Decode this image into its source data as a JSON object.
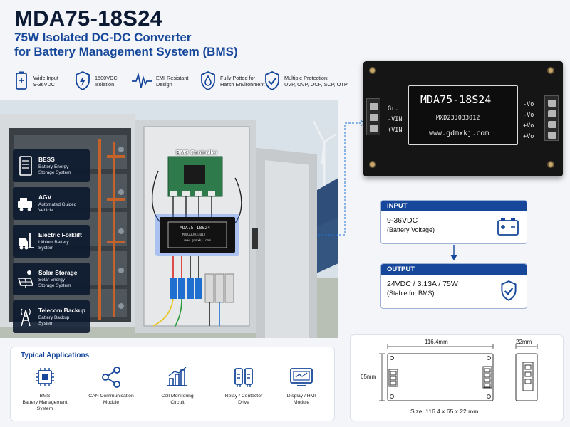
{
  "header": {
    "title": "MDA75-18S24",
    "subtitle_line1": "75W Isolated DC-DC Converter",
    "subtitle_line2": "for Battery Management System (BMS)"
  },
  "features": [
    {
      "icon": "battery-plus-icon",
      "line1": "Wide Input",
      "line2": "9-36VDC"
    },
    {
      "icon": "shield-lightning-icon",
      "line1": "1500VDC",
      "line2": "Isolation"
    },
    {
      "icon": "waveform-icon",
      "line1": "EMI Resistant",
      "line2": "Design"
    },
    {
      "icon": "shield-drop-icon",
      "line1": "Fully Potted for",
      "line2": "Harsh Environment"
    },
    {
      "icon": "shield-check-icon",
      "line1": "Multiple Protection:",
      "line2": "UVP, OVP, OCP, SCP, OTP"
    }
  ],
  "side_apps": [
    {
      "icon": "battery-cabinet-icon",
      "title": "BESS",
      "line1": "Battery Energy",
      "line2": "Storage System"
    },
    {
      "icon": "agv-icon",
      "title": "AGV",
      "line1": "Automated Guided",
      "line2": "Vehicle"
    },
    {
      "icon": "forklift-icon",
      "title": "Electric Forklift",
      "line1": "Lithium Battery",
      "line2": "System"
    },
    {
      "icon": "solar-panel-icon",
      "title": "Solar Storage",
      "line1": "Solar Energy",
      "line2": "Storage System"
    },
    {
      "icon": "telecom-tower-icon",
      "title": "Telecom Backup",
      "line1": "Battery Backup",
      "line2": "System"
    }
  ],
  "photo": {
    "bms_label": "BMS Controller",
    "module_label": "MDA75-18S24",
    "module_code": "MXD23J033012",
    "module_url": "www.gdmxkj.com"
  },
  "product": {
    "model": "MDA75-18S24",
    "code": "MXD23J033012",
    "url": "www.gdmxkj.com",
    "pins_left": [
      "Gr.",
      "-VIN",
      "+VIN"
    ],
    "pins_right": [
      "-Vo",
      "-Vo",
      "+Vo",
      "+Vo"
    ]
  },
  "input": {
    "header": "INPUT",
    "value": "9-36VDC",
    "note": "(Battery Voltage)",
    "icon": "battery-icon"
  },
  "output": {
    "header": "OUTPUT",
    "value": "24VDC / 3.13A / 75W",
    "note": "(Stable for BMS)",
    "icon": "shield-check-icon"
  },
  "applications": {
    "title": "Typical Applications",
    "items": [
      {
        "icon": "chip-icon",
        "line1": "BMS",
        "line2": "Battery Management",
        "line3": "System"
      },
      {
        "icon": "network-share-icon",
        "line1": "CAN Communication",
        "line2": "Module",
        "line3": ""
      },
      {
        "icon": "bar-chart-icon",
        "line1": "Cell Monitoring",
        "line2": "Circuit",
        "line3": ""
      },
      {
        "icon": "relay-icon",
        "line1": "Relay / Contactor",
        "line2": "Drive",
        "line3": ""
      },
      {
        "icon": "display-icon",
        "line1": "Display / HMI",
        "line2": "Module",
        "line3": ""
      }
    ]
  },
  "dimensions": {
    "width_label": "116.4mm",
    "height_label": "65mm",
    "depth_label": "22mm",
    "size_text": "Size: 116.4 x 65 x 22 mm"
  },
  "colors": {
    "brand_blue": "#16479a",
    "navy": "#0c1a33",
    "accent_glow": "#3b7cff"
  }
}
